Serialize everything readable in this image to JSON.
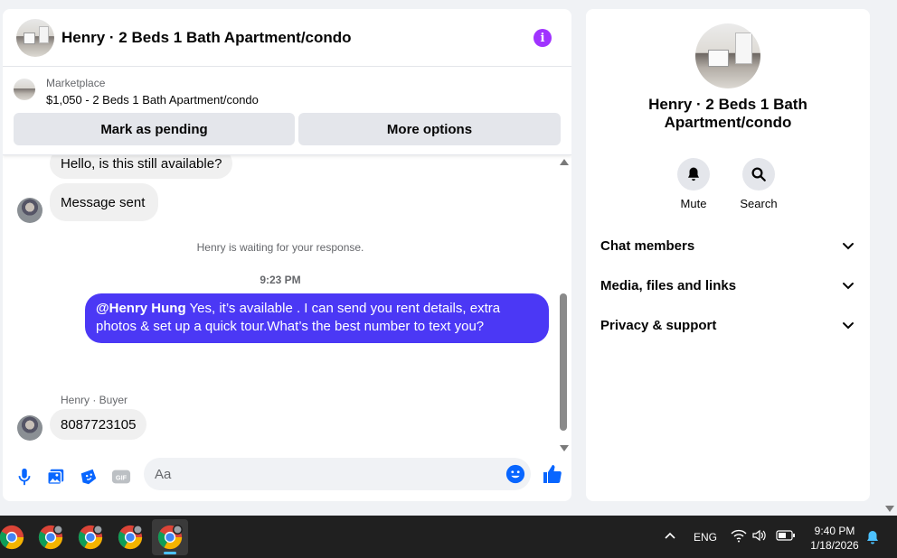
{
  "chat": {
    "title": "Henry · 2 Beds 1 Bath Apartment/condo",
    "marketplace": {
      "label": "Marketplace",
      "listing": "$1,050 - 2 Beds 1 Bath Apartment/condo",
      "pending_label": "Mark as pending",
      "more_label": "More options"
    },
    "messages": {
      "partial_message": "Hello, is this still available?",
      "sent_message": "Message sent",
      "waiting_note": "Henry is waiting for your response.",
      "timestamp": "9:23 PM",
      "outgoing_mention": "@Henry Hung",
      "outgoing_text": " Yes, it’s available .  I can send you rent details, extra photos & set up a quick tour.What’s the best number to text you?",
      "sender_label": "Henry · Buyer",
      "incoming_reply": "8087723105"
    },
    "composer": {
      "placeholder": "Aa",
      "gif_label": "GIF"
    },
    "accent_color": "#4b38f5"
  },
  "info_panel": {
    "title": "Henry · 2 Beds 1 Bath Apartment/condo",
    "actions": [
      {
        "label": "Mute",
        "icon": "bell-icon"
      },
      {
        "label": "Search",
        "icon": "search-icon"
      }
    ],
    "sections": [
      {
        "label": "Chat members"
      },
      {
        "label": "Media, files and links"
      },
      {
        "label": "Privacy & support"
      }
    ]
  },
  "taskbar": {
    "language": "ENG",
    "time": "9:40 PM",
    "date": "1/18/2026"
  }
}
